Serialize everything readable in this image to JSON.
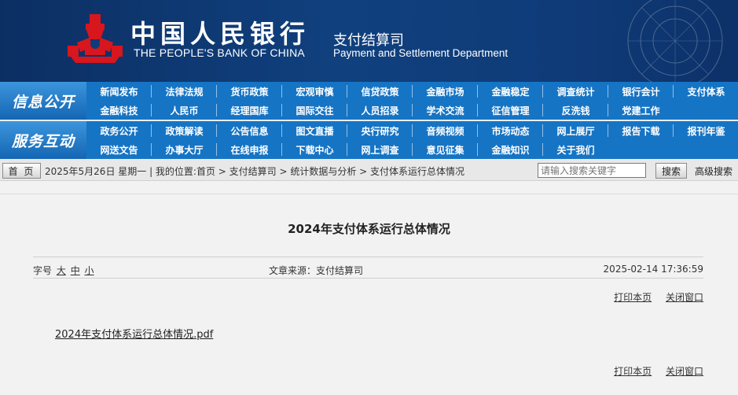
{
  "header": {
    "bank_name_cn": "中国人民银行",
    "bank_name_en": "THE PEOPLE'S BANK OF CHINA",
    "dept_name_cn": "支付结算司",
    "dept_name_en": "Payment and Settlement Department",
    "logo_color": "#d7161e"
  },
  "nav": {
    "section1_title": "信息公开",
    "section1_items": [
      "新闻发布",
      "法律法规",
      "货币政策",
      "宏观审慎",
      "信贷政策",
      "金融市场",
      "金融稳定",
      "调查统计",
      "银行会计",
      "支付体系",
      "金融科技",
      "人民币",
      "经理国库",
      "国际交往",
      "人员招录",
      "学术交流",
      "征信管理",
      "反洗钱",
      "党建工作"
    ],
    "section2_title": "服务互动",
    "section2_items": [
      "政务公开",
      "政策解读",
      "公告信息",
      "图文直播",
      "央行研究",
      "音频视频",
      "市场动态",
      "网上展厅",
      "报告下载",
      "报刊年鉴",
      "网送文告",
      "办事大厅",
      "在线申报",
      "下载中心",
      "网上调查",
      "意见征集",
      "金融知识",
      "关于我们"
    ]
  },
  "crumbbar": {
    "home_label": "首 页",
    "crumb_text": "2025年5月26日 星期一 | 我的位置:首页 > 支付结算司 > 统计数据与分析 > 支付体系运行总体情况",
    "search_placeholder": "请输入搜索关键字",
    "search_button": "搜索",
    "advanced_search": "高级搜索"
  },
  "article": {
    "title": "2024年支付体系运行总体情况",
    "font_size_label": "字号",
    "font_large": "大",
    "font_medium": "中",
    "font_small": "小",
    "source": "文章来源：支付结算司",
    "date": "2025-02-14 17:36:59",
    "print_label": "打印本页",
    "close_label": "关闭窗口",
    "attachment": "2024年支付体系运行总体情况.pdf"
  }
}
